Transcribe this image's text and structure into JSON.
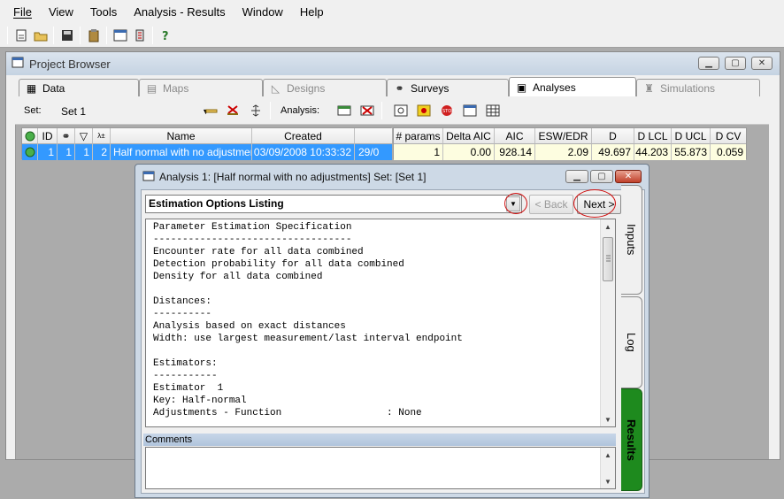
{
  "menu": [
    "File",
    "View",
    "Tools",
    "Analysis - Results",
    "Window",
    "Help"
  ],
  "project_browser": {
    "title": "Project Browser",
    "tabs": [
      {
        "label": "Data",
        "icon": "data-icon",
        "state": "normal"
      },
      {
        "label": "Maps",
        "icon": "map-icon",
        "state": "disabled"
      },
      {
        "label": "Designs",
        "icon": "design-icon",
        "state": "disabled"
      },
      {
        "label": "Surveys",
        "icon": "binoculars-icon",
        "state": "normal"
      },
      {
        "label": "Analyses",
        "icon": "analysis-icon",
        "state": "active"
      },
      {
        "label": "Simulations",
        "icon": "simulation-icon",
        "state": "disabled"
      }
    ],
    "set_label": "Set:",
    "set_value": "Set 1",
    "analysis_label": "Analysis:",
    "left_columns": [
      "ID",
      "Name",
      "Created"
    ],
    "left_row": {
      "id": "1",
      "c2": "1",
      "c3": "1",
      "c4": "2",
      "name": "Half normal with no adjustments",
      "created": "03/09/2008 10:33:32",
      "extra": "29/0"
    },
    "right_columns": [
      "# params",
      "Delta AIC",
      "AIC",
      "ESW/EDR",
      "D",
      "D LCL",
      "D UCL",
      "D CV"
    ],
    "right_row": [
      "1",
      "0.00",
      "928.14",
      "2.09",
      "49.697",
      "44.203",
      "55.873",
      "0.059"
    ]
  },
  "dialog": {
    "title": "Analysis 1: [Half normal with no adjustments] Set: [Set 1]",
    "combo_value": "Estimation Options Listing",
    "back_label": "< Back",
    "next_label": "Next >",
    "text_lines": [
      "Parameter Estimation Specification",
      "----------------------------------",
      "Encounter rate for all data combined",
      "Detection probability for all data combined",
      "Density for all data combined",
      "",
      "Distances:",
      "----------",
      "Analysis based on exact distances",
      "Width: use largest measurement/last interval endpoint",
      "",
      "Estimators:",
      "-----------",
      "Estimator  1",
      "Key: Half-normal",
      "Adjustments - Function                  : None"
    ],
    "comments_label": "Comments",
    "side_tabs": [
      "Inputs",
      "Log",
      "Results"
    ]
  },
  "colors": {
    "selection": "#3399ff",
    "results_tab": "#1e8a1e",
    "annotation_circle": "#d01010"
  }
}
